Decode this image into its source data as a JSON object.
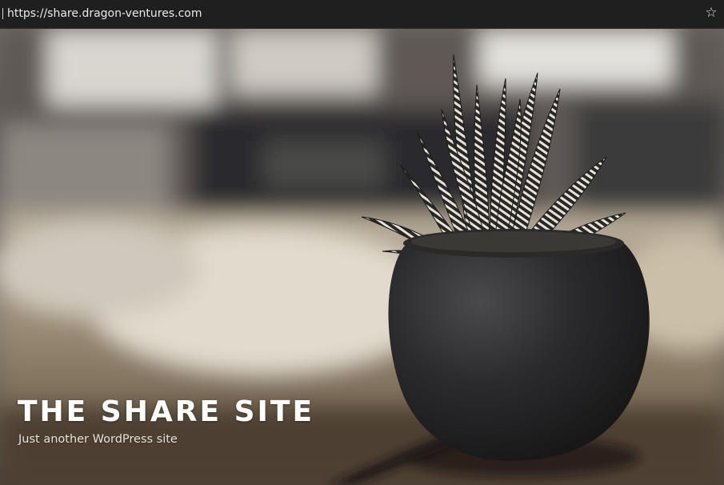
{
  "browser": {
    "url": "https://share.dragon-ventures.com",
    "bookmark_icon": "star-icon"
  },
  "site": {
    "title": "THE SHARE SITE",
    "tagline": "Just another WordPress site"
  },
  "hero_image": {
    "subject": "potted succulent plant"
  }
}
